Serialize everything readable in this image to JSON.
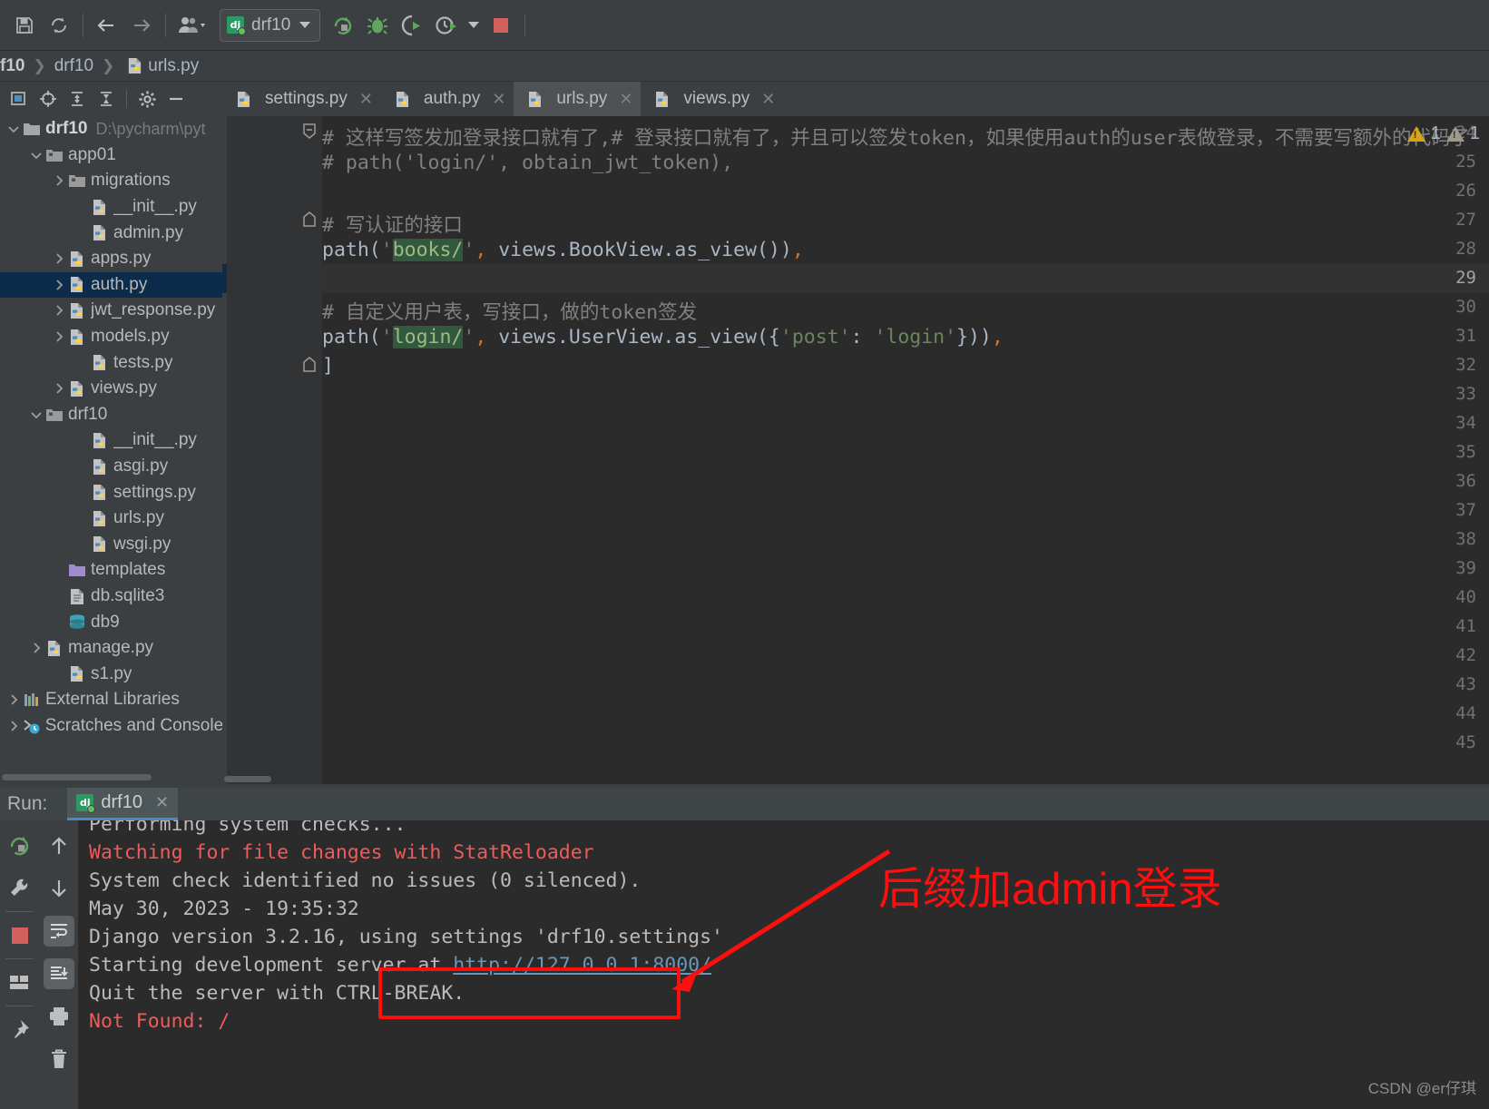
{
  "toolbar": {
    "icons": [
      "save-icon",
      "sync-icon",
      "back-arrow-icon",
      "forward-arrow-icon",
      "user-group-icon"
    ],
    "run_config": {
      "label": "drf10",
      "badge": "dj"
    },
    "actions": [
      "rerun-icon",
      "debug-bug-icon",
      "coverage-icon",
      "profile-icon",
      "stop-icon"
    ]
  },
  "breadcrumb": {
    "items": [
      "f10",
      "drf10",
      "urls.py"
    ]
  },
  "project_toolbar": {
    "icons": [
      "select-target-icon",
      "locate-icon",
      "expand-all-icon",
      "collapse-all-icon",
      "settings-gear-icon",
      "hide-icon"
    ]
  },
  "tree": {
    "items": [
      {
        "label": "drf10",
        "path": "D:\\pycharm\\pyt",
        "indent": 0,
        "arrow": "down",
        "icon": "folder",
        "bold": true,
        "selected": false
      },
      {
        "label": "app01",
        "path": "",
        "indent": 1,
        "arrow": "down",
        "icon": "module-folder",
        "bold": false,
        "selected": false
      },
      {
        "label": "migrations",
        "path": "",
        "indent": 2,
        "arrow": "right",
        "icon": "module-folder",
        "bold": false,
        "selected": false
      },
      {
        "label": "__init__.py",
        "path": "",
        "indent": 3,
        "arrow": "none",
        "icon": "python",
        "bold": false,
        "selected": false
      },
      {
        "label": "admin.py",
        "path": "",
        "indent": 3,
        "arrow": "none",
        "icon": "python",
        "bold": false,
        "selected": false
      },
      {
        "label": "apps.py",
        "path": "",
        "indent": 2,
        "arrow": "right",
        "icon": "python",
        "bold": false,
        "selected": false
      },
      {
        "label": "auth.py",
        "path": "",
        "indent": 2,
        "arrow": "right",
        "icon": "python",
        "bold": false,
        "selected": true
      },
      {
        "label": "jwt_response.py",
        "path": "",
        "indent": 2,
        "arrow": "right",
        "icon": "python",
        "bold": false,
        "selected": false
      },
      {
        "label": "models.py",
        "path": "",
        "indent": 2,
        "arrow": "right",
        "icon": "python",
        "bold": false,
        "selected": false
      },
      {
        "label": "tests.py",
        "path": "",
        "indent": 3,
        "arrow": "none",
        "icon": "python",
        "bold": false,
        "selected": false
      },
      {
        "label": "views.py",
        "path": "",
        "indent": 2,
        "arrow": "right",
        "icon": "python",
        "bold": false,
        "selected": false
      },
      {
        "label": "drf10",
        "path": "",
        "indent": 1,
        "arrow": "down",
        "icon": "module-folder",
        "bold": false,
        "selected": false
      },
      {
        "label": "__init__.py",
        "path": "",
        "indent": 3,
        "arrow": "none",
        "icon": "python",
        "bold": false,
        "selected": false
      },
      {
        "label": "asgi.py",
        "path": "",
        "indent": 3,
        "arrow": "none",
        "icon": "python",
        "bold": false,
        "selected": false
      },
      {
        "label": "settings.py",
        "path": "",
        "indent": 3,
        "arrow": "none",
        "icon": "python",
        "bold": false,
        "selected": false
      },
      {
        "label": "urls.py",
        "path": "",
        "indent": 3,
        "arrow": "none",
        "icon": "python",
        "bold": false,
        "selected": false
      },
      {
        "label": "wsgi.py",
        "path": "",
        "indent": 3,
        "arrow": "none",
        "icon": "python",
        "bold": false,
        "selected": false
      },
      {
        "label": "templates",
        "path": "",
        "indent": 2,
        "arrow": "none",
        "icon": "templates-folder",
        "bold": false,
        "selected": false
      },
      {
        "label": "db.sqlite3",
        "path": "",
        "indent": 2,
        "arrow": "none",
        "icon": "file",
        "bold": false,
        "selected": false
      },
      {
        "label": "db9",
        "path": "",
        "indent": 2,
        "arrow": "none",
        "icon": "database",
        "bold": false,
        "selected": false
      },
      {
        "label": "manage.py",
        "path": "",
        "indent": 1,
        "arrow": "right",
        "icon": "python",
        "bold": false,
        "selected": false
      },
      {
        "label": "s1.py",
        "path": "",
        "indent": 2,
        "arrow": "none",
        "icon": "python",
        "bold": false,
        "selected": false
      },
      {
        "label": "External Libraries",
        "path": "",
        "indent": 0,
        "arrow": "right",
        "icon": "libraries",
        "bold": false,
        "selected": false
      },
      {
        "label": "Scratches and Consoles",
        "path": "",
        "indent": 0,
        "arrow": "right",
        "icon": "scratches",
        "bold": false,
        "selected": false
      }
    ]
  },
  "editor_tabs": [
    {
      "label": "settings.py",
      "active": false
    },
    {
      "label": "auth.py",
      "active": false
    },
    {
      "label": "urls.py",
      "active": true
    },
    {
      "label": "views.py",
      "active": false
    }
  ],
  "editor": {
    "first_line": 24,
    "last_line": 45,
    "current_line": 29,
    "inspections": {
      "warning_count": "1",
      "weak_warning_count": "1"
    },
    "lines": [
      {
        "no": 24,
        "fold": "collapse",
        "segments": [
          {
            "t": "# 这样写签发加登录接口就有了,# 登录接口就有了，并且可以签发token，如果使用auth的user表做登录，不需要写额外的代码了",
            "c": "cm"
          }
        ]
      },
      {
        "no": 25,
        "fold": "none",
        "segments": [
          {
            "t": "# path('login/', obtain_jwt_token),",
            "c": "cm"
          }
        ]
      },
      {
        "no": 26,
        "fold": "none",
        "segments": []
      },
      {
        "no": 27,
        "fold": "region",
        "segments": [
          {
            "t": "# 写认证的接口",
            "c": "cm"
          }
        ]
      },
      {
        "no": 28,
        "fold": "none",
        "segments": [
          {
            "t": "path(",
            "c": "plain"
          },
          {
            "t": "'",
            "c": "str"
          },
          {
            "t": "books/",
            "c": "strhl"
          },
          {
            "t": "'",
            "c": "str"
          },
          {
            "t": ",",
            "c": "punc"
          },
          {
            "t": " views.BookView.as_view())",
            "c": "plain"
          },
          {
            "t": ",",
            "c": "punc"
          }
        ]
      },
      {
        "no": 29,
        "fold": "none",
        "segments": []
      },
      {
        "no": 30,
        "fold": "none",
        "segments": [
          {
            "t": "# 自定义用户表，写接口，做的token签发",
            "c": "cm"
          }
        ]
      },
      {
        "no": 31,
        "fold": "none",
        "segments": [
          {
            "t": "path(",
            "c": "plain"
          },
          {
            "t": "'",
            "c": "str"
          },
          {
            "t": "login/",
            "c": "strhl"
          },
          {
            "t": "'",
            "c": "str"
          },
          {
            "t": ",",
            "c": "punc"
          },
          {
            "t": " views.UserView.as_view({",
            "c": "plain"
          },
          {
            "t": "'post'",
            "c": "str"
          },
          {
            "t": ": ",
            "c": "plain"
          },
          {
            "t": "'login'",
            "c": "str"
          },
          {
            "t": "}))",
            "c": "plain"
          },
          {
            "t": ",",
            "c": "punc"
          }
        ]
      },
      {
        "no": 32,
        "fold": "end",
        "segments": [
          {
            "t": "]",
            "c": "plain"
          }
        ]
      },
      {
        "no": 33,
        "fold": "none",
        "segments": []
      },
      {
        "no": 34,
        "fold": "none",
        "segments": []
      },
      {
        "no": 35,
        "fold": "none",
        "segments": []
      },
      {
        "no": 36,
        "fold": "none",
        "segments": []
      },
      {
        "no": 37,
        "fold": "none",
        "segments": []
      },
      {
        "no": 38,
        "fold": "none",
        "segments": []
      },
      {
        "no": 39,
        "fold": "none",
        "segments": []
      },
      {
        "no": 40,
        "fold": "none",
        "segments": []
      },
      {
        "no": 41,
        "fold": "none",
        "segments": []
      },
      {
        "no": 42,
        "fold": "none",
        "segments": []
      },
      {
        "no": 43,
        "fold": "none",
        "segments": []
      },
      {
        "no": 44,
        "fold": "none",
        "segments": []
      },
      {
        "no": 45,
        "fold": "none",
        "segments": []
      }
    ]
  },
  "run_panel": {
    "title": "Run:",
    "tab": {
      "label": "drf10",
      "badge": "dj"
    },
    "side_icons_left": [
      "rerun-icon",
      "wrench-settings-icon",
      "stop-icon",
      "layout-icon",
      "pin-icon"
    ],
    "side_icons_right": [
      "up-arrow-icon",
      "down-arrow-icon",
      "soft-wrap-icon",
      "scroll-to-end-icon",
      "print-icon",
      "trash-icon"
    ],
    "console_lines": [
      {
        "text": "Performing system checks...",
        "style": "normal",
        "clipped": true
      },
      {
        "text": "Watching for file changes with StatReloader",
        "style": "error"
      },
      {
        "text": "System check identified no issues (0 silenced).",
        "style": "normal"
      },
      {
        "text": "May 30, 2023 - 19:35:32",
        "style": "normal"
      },
      {
        "text": "Django version 3.2.16, using settings 'drf10.settings'",
        "style": "normal"
      },
      {
        "text": "Starting development server at ",
        "style": "normal",
        "link": "http://127.0.0.1:8000/"
      },
      {
        "text": "Quit the server with CTRL-BREAK.",
        "style": "normal"
      },
      {
        "text": "Not Found: /",
        "style": "error"
      }
    ]
  },
  "annotation": {
    "text": "后缀加admin登录",
    "color": "#fb0f0f"
  },
  "watermark": {
    "text": "CSDN @er仔琪"
  }
}
